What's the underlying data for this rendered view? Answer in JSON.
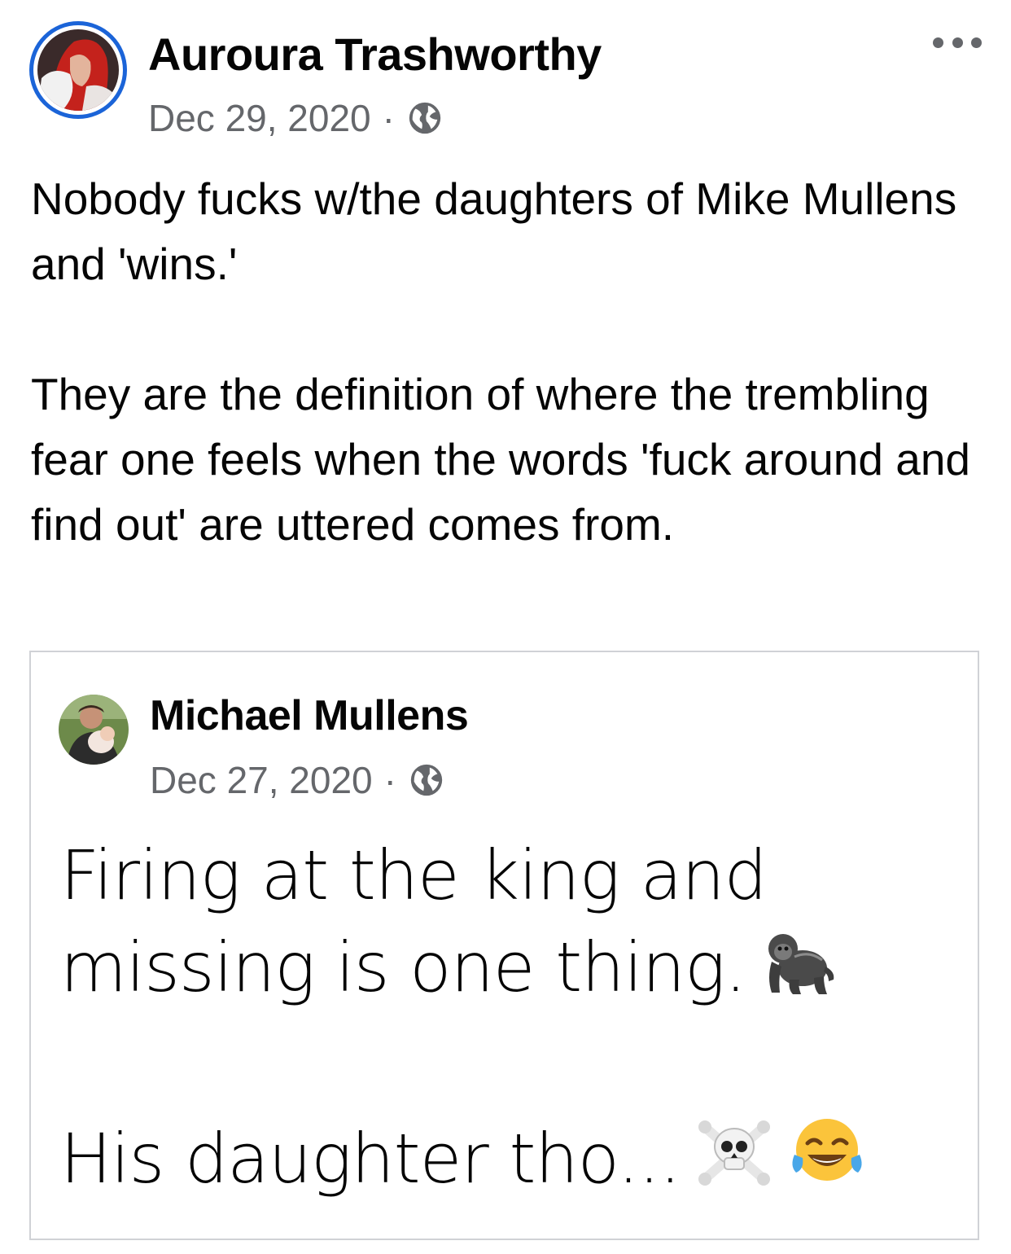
{
  "post": {
    "author": "Auroura Trashworthy",
    "date": "Dec 29, 2020",
    "separator": "·",
    "privacy_icon": "globe-icon",
    "more_icon": "more-options-icon",
    "text": "Nobody fucks w/the daughters of Mike Mullens and 'wins.'\n\nThey are the definition of where the trembling fear one feels when the words 'fuck around and find out' are uttered comes from."
  },
  "shared_post": {
    "author": "Michael Mullens",
    "date": "Dec 27, 2020",
    "separator": "·",
    "privacy_icon": "globe-icon",
    "lines": [
      "Firing at the king and",
      "missing is one thing.",
      "His daughter tho..."
    ],
    "emojis": {
      "line2": "gorilla-emoji",
      "line3": [
        "skull-crossbones-emoji",
        "tears-of-joy-emoji"
      ]
    }
  },
  "colors": {
    "text": "#050505",
    "secondary": "#65676b",
    "avatar_ring": "#1b64d8",
    "shared_border": "#d0d2d6"
  }
}
